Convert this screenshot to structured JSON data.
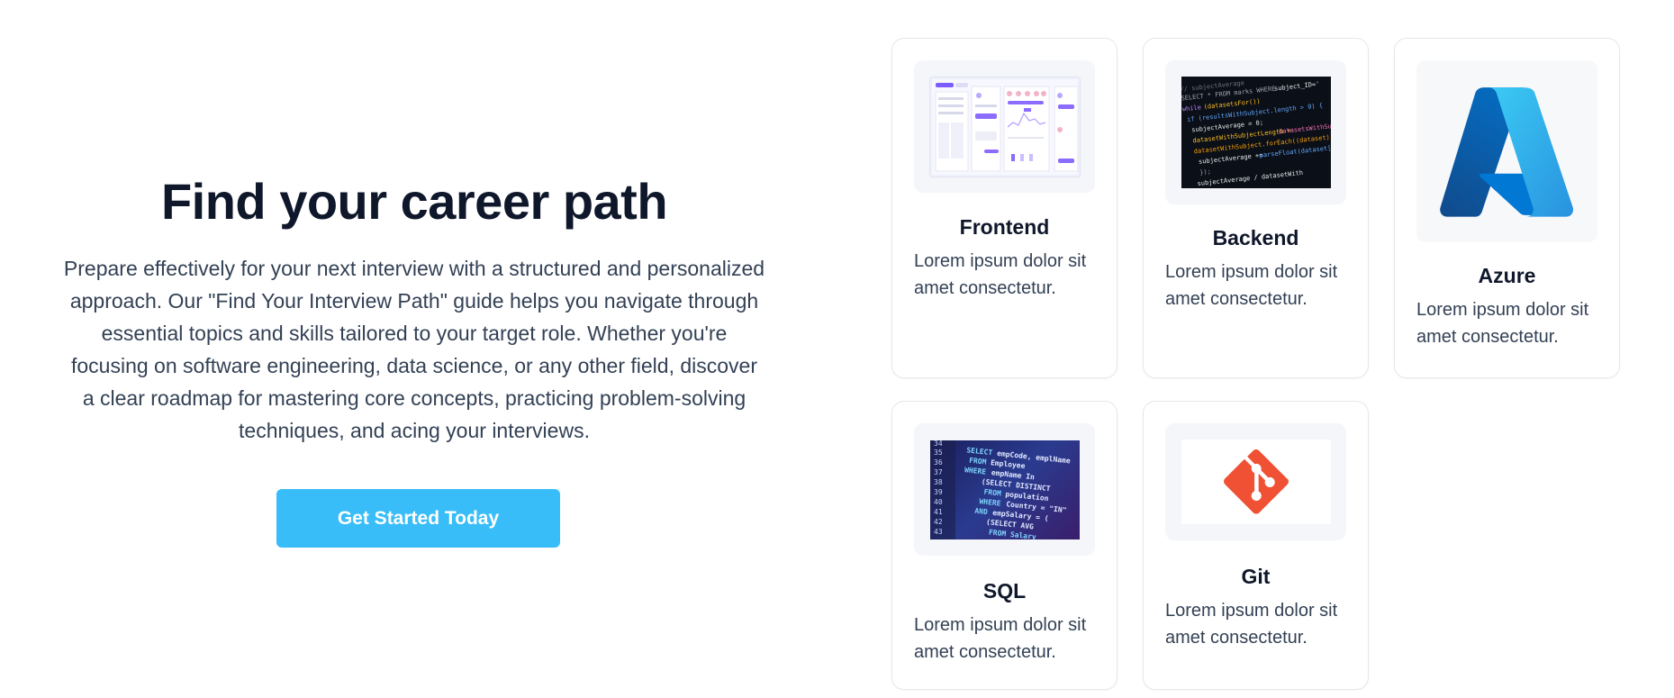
{
  "hero": {
    "title": "Find your career path",
    "description": "Prepare effectively for your next interview with a structured and personalized approach. Our \"Find Your Interview Path\" guide helps you navigate through essential topics and skills tailored to your target role. Whether you're focusing on software engineering, data science, or any other field, discover a clear roadmap for mastering core concepts, practicing problem-solving techniques, and acing your interviews.",
    "cta_label": "Get Started Today"
  },
  "cards": [
    {
      "title": "Frontend",
      "description": "Lorem ipsum dolor sit amet consectetur.",
      "image": "dashboard-ui-mockup"
    },
    {
      "title": "Backend",
      "description": "Lorem ipsum dolor sit amet consectetur.",
      "image": "code-editor-screenshot"
    },
    {
      "title": "Azure",
      "description": "Lorem ipsum dolor sit amet consectetur.",
      "image": "azure-logo"
    },
    {
      "title": "SQL",
      "description": "Lorem ipsum dolor sit amet consectetur.",
      "image": "sql-code-screenshot"
    },
    {
      "title": "Git",
      "description": "Lorem ipsum dolor sit amet consectetur.",
      "image": "git-logo"
    }
  ],
  "colors": {
    "accent": "#38bdf8",
    "heading": "#0f172a",
    "body_text": "#334155",
    "card_border": "#e5e7eb",
    "azure_blue": "#0078d4",
    "git_orange": "#f05033"
  }
}
